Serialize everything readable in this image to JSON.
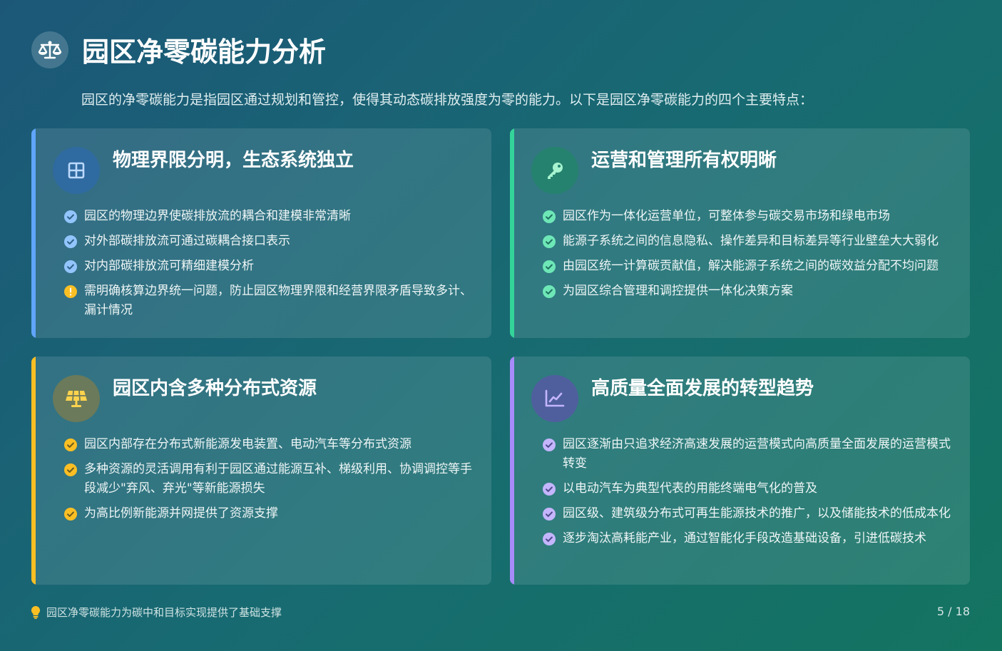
{
  "header": {
    "title": "园区净零碳能力分析",
    "intro": "园区的净零碳能力是指园区通过规划和管控，使得其动态碳排放强度为零的能力。以下是园区净零碳能力的四个主要特点："
  },
  "cards": [
    {
      "title": "物理界限分明，生态系统独立",
      "icon": "grid-icon",
      "accent": "#60a5fa",
      "items": [
        {
          "text": "园区的物理边界使碳排放流的耦合和建模非常清晰",
          "marker": "check"
        },
        {
          "text": "对外部碳排放流可通过碳耦合接口表示",
          "marker": "check"
        },
        {
          "text": "对内部碳排放流可精细建模分析",
          "marker": "check"
        },
        {
          "text": "需明确核算边界统一问题，防止园区物理界限和经营界限矛盾导致多计、漏计情况",
          "marker": "warning"
        }
      ]
    },
    {
      "title": "运营和管理所有权明晰",
      "icon": "key-icon",
      "accent": "#34d399",
      "items": [
        {
          "text": "园区作为一体化运营单位，可整体参与碳交易市场和绿电市场",
          "marker": "check"
        },
        {
          "text": "能源子系统之间的信息隐私、操作差异和目标差异等行业壁垒大大弱化",
          "marker": "check"
        },
        {
          "text": "由园区统一计算碳贡献值，解决能源子系统之间的碳效益分配不均问题",
          "marker": "check"
        },
        {
          "text": "为园区综合管理和调控提供一体化决策方案",
          "marker": "check"
        }
      ]
    },
    {
      "title": "园区内含多种分布式资源",
      "icon": "solar-panel-icon",
      "accent": "#fbbf24",
      "items": [
        {
          "text": "园区内部存在分布式新能源发电装置、电动汽车等分布式资源",
          "marker": "check"
        },
        {
          "text": "多种资源的灵活调用有利于园区通过能源互补、梯级利用、协调调控等手段减少\"弃风、弃光\"等新能源损失",
          "marker": "check"
        },
        {
          "text": "为高比例新能源并网提供了资源支撑",
          "marker": "check"
        }
      ]
    },
    {
      "title": "高质量全面发展的转型趋势",
      "icon": "line-chart-icon",
      "accent": "#a78bfa",
      "items": [
        {
          "text": "园区逐渐由只追求经济高速发展的运营模式向高质量全面发展的运营模式转变",
          "marker": "check"
        },
        {
          "text": "以电动汽车为典型代表的用能终端电气化的普及",
          "marker": "check"
        },
        {
          "text": "园区级、建筑级分布式可再生能源技术的推广，以及储能技术的低成本化",
          "marker": "check"
        },
        {
          "text": "逐步淘汰高耗能产业，通过智能化手段改造基础设备，引进低碳技术",
          "marker": "check"
        }
      ]
    }
  ],
  "footer": {
    "note": "园区净零碳能力为碳中和目标实现提供了基础支撑",
    "page": "5 / 18"
  }
}
